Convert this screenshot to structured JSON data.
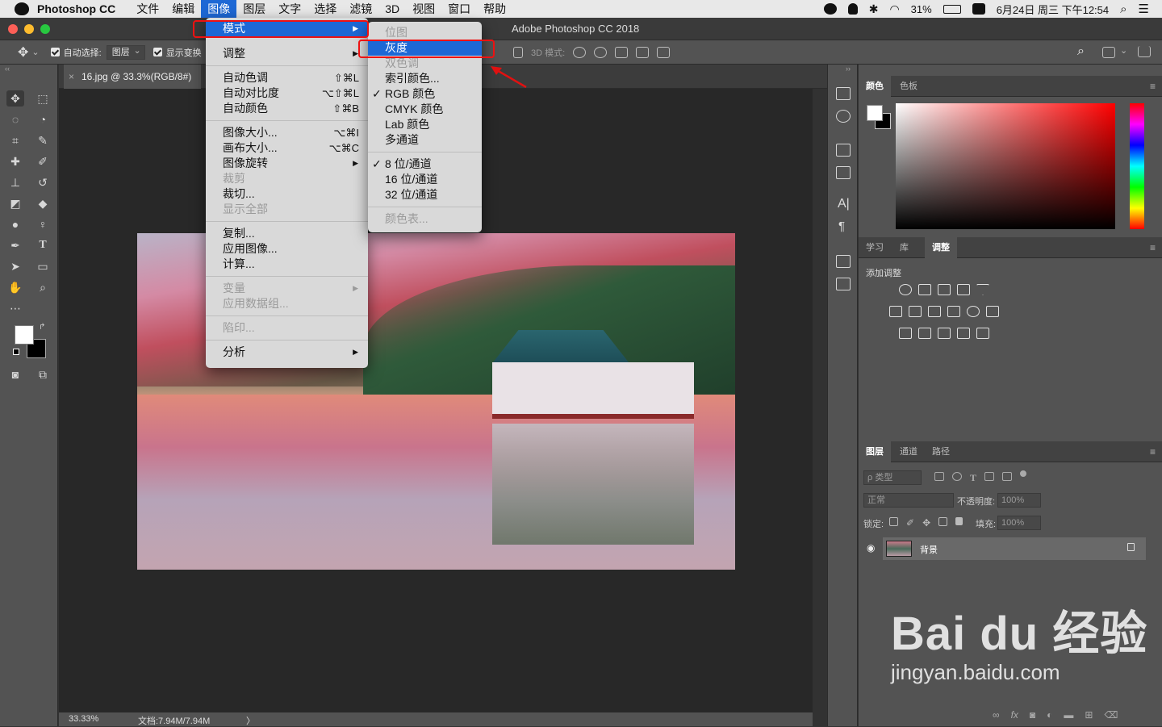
{
  "menubar": {
    "app_name": "Photoshop CC",
    "items": [
      "文件",
      "编辑",
      "图像",
      "图层",
      "文字",
      "选择",
      "滤镜",
      "3D",
      "视图",
      "窗口",
      "帮助"
    ],
    "battery": "31%",
    "datetime": "6月24日 周三 下午12:54"
  },
  "window": {
    "title": "Adobe Photoshop CC 2018"
  },
  "options_bar": {
    "auto_select_label": "自动选择:",
    "auto_select_value": "图层",
    "show_transform_label": "显示变换",
    "mode_3d_label": "3D 模式:"
  },
  "document": {
    "tab_title": "16.jpg @ 33.3%(RGB/8#)",
    "close_glyph": "×"
  },
  "status": {
    "zoom": "33.33%",
    "doc_size": "文档:7.94M/7.94M",
    "arrow": "〉"
  },
  "image_menu": {
    "groups": [
      [
        {
          "label": "模式",
          "submenu": true,
          "highlighted": true
        },
        {
          "label": "调整",
          "submenu": true
        }
      ],
      [
        {
          "label": "自动色调",
          "shortcut": "⇧⌘L"
        },
        {
          "label": "自动对比度",
          "shortcut": "⌥⇧⌘L"
        },
        {
          "label": "自动颜色",
          "shortcut": "⇧⌘B"
        }
      ],
      [
        {
          "label": "图像大小...",
          "shortcut": "⌥⌘I"
        },
        {
          "label": "画布大小...",
          "shortcut": "⌥⌘C"
        },
        {
          "label": "图像旋转",
          "submenu": true
        },
        {
          "label": "裁剪",
          "disabled": true
        },
        {
          "label": "裁切..."
        },
        {
          "label": "显示全部",
          "disabled": true
        }
      ],
      [
        {
          "label": "复制..."
        },
        {
          "label": "应用图像..."
        },
        {
          "label": "计算..."
        }
      ],
      [
        {
          "label": "变量",
          "submenu": true,
          "disabled": true
        },
        {
          "label": "应用数据组...",
          "disabled": true
        }
      ],
      [
        {
          "label": "陷印...",
          "disabled": true
        }
      ],
      [
        {
          "label": "分析",
          "submenu": true
        }
      ]
    ]
  },
  "mode_submenu": {
    "groups": [
      [
        {
          "label": "位图",
          "disabled": true
        },
        {
          "label": "灰度",
          "highlighted": true
        },
        {
          "label": "双色调",
          "disabled": true
        },
        {
          "label": "索引颜色..."
        },
        {
          "label": "RGB 颜色",
          "checked": true
        },
        {
          "label": "CMYK 颜色"
        },
        {
          "label": "Lab 颜色"
        },
        {
          "label": "多通道"
        }
      ],
      [
        {
          "label": "8 位/通道",
          "checked": true
        },
        {
          "label": "16 位/通道"
        },
        {
          "label": "32 位/通道"
        }
      ],
      [
        {
          "label": "颜色表...",
          "disabled": true
        }
      ]
    ],
    "check_glyph": "✓"
  },
  "panels": {
    "color_tabs": [
      "颜色",
      "色板"
    ],
    "adjust_tabs": [
      "学习",
      "库",
      "调整"
    ],
    "adjust_title": "添加调整",
    "layers_tabs": [
      "图层",
      "通道",
      "路径"
    ],
    "filter_kind": "ρ 类型",
    "blend_mode": "正常",
    "opacity_label": "不透明度:",
    "opacity_value": "100%",
    "lock_label": "锁定:",
    "fill_label": "填充:",
    "fill_value": "100%",
    "layer_name": "背景"
  },
  "colors": {
    "accent": "#1d68d5",
    "annotation": "#e11111",
    "fg": "#ffffff",
    "bg": "#000000"
  },
  "watermark": {
    "line1": "Bai du 经验",
    "line2": "jingyan.baidu.com"
  }
}
